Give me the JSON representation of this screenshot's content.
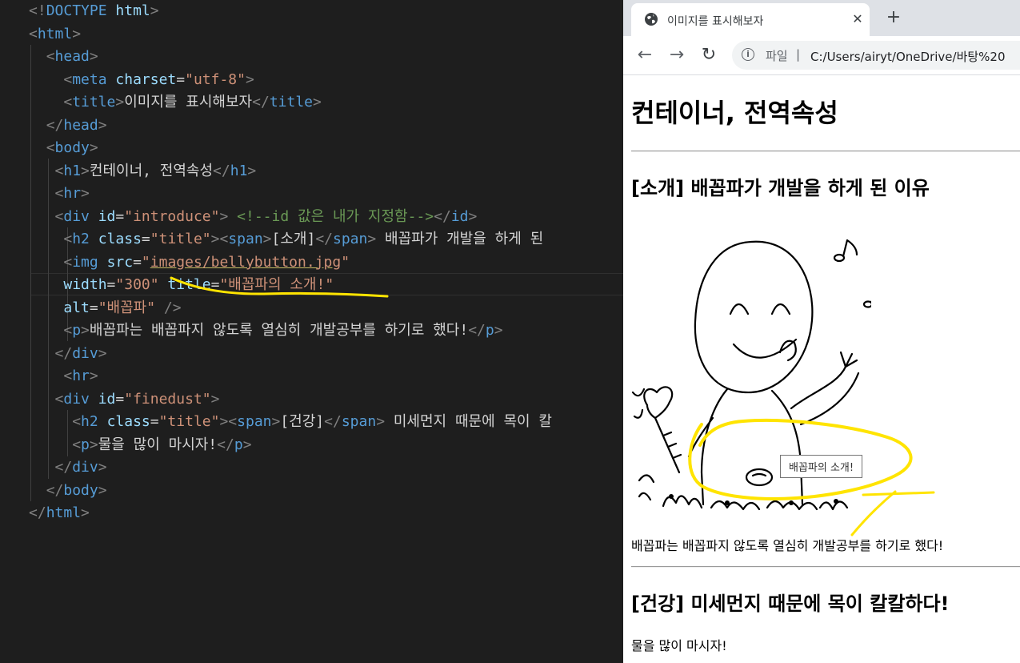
{
  "editor": {
    "lines": [
      [
        [
          "p",
          "<!"
        ],
        [
          "t",
          "DOCTYPE"
        ],
        [
          "x",
          " "
        ],
        [
          "a",
          "html"
        ],
        [
          "p",
          ">"
        ]
      ],
      [
        [
          "p",
          "<"
        ],
        [
          "t",
          "html"
        ],
        [
          "p",
          ">"
        ]
      ],
      [
        [
          "x",
          "  "
        ],
        [
          "p",
          "<"
        ],
        [
          "t",
          "head"
        ],
        [
          "p",
          ">"
        ]
      ],
      [
        [
          "x",
          "    "
        ],
        [
          "p",
          "<"
        ],
        [
          "t",
          "meta"
        ],
        [
          "x",
          " "
        ],
        [
          "a",
          "charset"
        ],
        [
          "x",
          "="
        ],
        [
          "s",
          "\"utf-8\""
        ],
        [
          "p",
          ">"
        ]
      ],
      [
        [
          "x",
          "    "
        ],
        [
          "p",
          "<"
        ],
        [
          "t",
          "title"
        ],
        [
          "p",
          ">"
        ],
        [
          "x",
          "이미지를 표시해보자"
        ],
        [
          "p",
          "</"
        ],
        [
          "t",
          "title"
        ],
        [
          "p",
          ">"
        ]
      ],
      [
        [
          "x",
          "  "
        ],
        [
          "p",
          "</"
        ],
        [
          "t",
          "head"
        ],
        [
          "p",
          ">"
        ]
      ],
      [
        [
          "x",
          "  "
        ],
        [
          "p",
          "<"
        ],
        [
          "t",
          "body"
        ],
        [
          "p",
          ">"
        ]
      ],
      [
        [
          "x",
          "   "
        ],
        [
          "p",
          "<"
        ],
        [
          "t",
          "h1"
        ],
        [
          "p",
          ">"
        ],
        [
          "x",
          "컨테이너, 전역속성"
        ],
        [
          "p",
          "</"
        ],
        [
          "t",
          "h1"
        ],
        [
          "p",
          ">"
        ]
      ],
      [
        [
          "x",
          "   "
        ],
        [
          "p",
          "<"
        ],
        [
          "t",
          "hr"
        ],
        [
          "p",
          ">"
        ]
      ],
      [
        [
          "x",
          "   "
        ],
        [
          "p",
          "<"
        ],
        [
          "t",
          "div"
        ],
        [
          "x",
          " "
        ],
        [
          "a",
          "id"
        ],
        [
          "x",
          "="
        ],
        [
          "s",
          "\"introduce\""
        ],
        [
          "p",
          ">"
        ],
        [
          "x",
          " "
        ],
        [
          "c",
          "<!--id 값은 내가 지정함-->"
        ],
        [
          "p",
          "</"
        ],
        [
          "t",
          "id"
        ],
        [
          "p",
          ">"
        ]
      ],
      [
        [
          "x",
          "    "
        ],
        [
          "p",
          "<"
        ],
        [
          "t",
          "h2"
        ],
        [
          "x",
          " "
        ],
        [
          "a",
          "class"
        ],
        [
          "x",
          "="
        ],
        [
          "s",
          "\"title\""
        ],
        [
          "p",
          ">"
        ],
        [
          "p",
          "<"
        ],
        [
          "t",
          "span"
        ],
        [
          "p",
          ">"
        ],
        [
          "x",
          "[소개]"
        ],
        [
          "p",
          "</"
        ],
        [
          "t",
          "span"
        ],
        [
          "p",
          ">"
        ],
        [
          "x",
          " 배꼽파가 개발을 하게 된"
        ]
      ],
      [
        [
          "x",
          "    "
        ],
        [
          "p",
          "<"
        ],
        [
          "t",
          "img"
        ],
        [
          "x",
          " "
        ],
        [
          "a",
          "src"
        ],
        [
          "x",
          "="
        ],
        [
          "s",
          "\""
        ],
        [
          "su",
          "images/bellybutton.jpg"
        ],
        [
          "s",
          "\""
        ]
      ],
      [
        [
          "x",
          "    "
        ],
        [
          "a",
          "width"
        ],
        [
          "x",
          "="
        ],
        [
          "s",
          "\"300\""
        ],
        [
          "x",
          " "
        ],
        [
          "a",
          "title"
        ],
        [
          "x",
          "="
        ],
        [
          "s",
          "\"배꼽파의 소개!\""
        ]
      ],
      [
        [
          "x",
          "    "
        ],
        [
          "a",
          "alt"
        ],
        [
          "x",
          "="
        ],
        [
          "s",
          "\"배꼽파\""
        ],
        [
          "x",
          " "
        ],
        [
          "p",
          "/>"
        ]
      ],
      [
        [
          "x",
          "    "
        ],
        [
          "p",
          "<"
        ],
        [
          "t",
          "p"
        ],
        [
          "p",
          ">"
        ],
        [
          "x",
          "배꼽파는 배꼽파지 않도록 열심히 개발공부를 하기로 했다!"
        ],
        [
          "p",
          "</"
        ],
        [
          "t",
          "p"
        ],
        [
          "p",
          ">"
        ]
      ],
      [
        [
          "x",
          "   "
        ],
        [
          "p",
          "</"
        ],
        [
          "t",
          "div"
        ],
        [
          "p",
          ">"
        ]
      ],
      [
        [
          "x",
          "    "
        ],
        [
          "p",
          "<"
        ],
        [
          "t",
          "hr"
        ],
        [
          "p",
          ">"
        ]
      ],
      [
        [
          "x",
          "   "
        ],
        [
          "p",
          "<"
        ],
        [
          "t",
          "div"
        ],
        [
          "x",
          " "
        ],
        [
          "a",
          "id"
        ],
        [
          "x",
          "="
        ],
        [
          "s",
          "\"finedust\""
        ],
        [
          "p",
          ">"
        ]
      ],
      [
        [
          "x",
          "     "
        ],
        [
          "p",
          "<"
        ],
        [
          "t",
          "h2"
        ],
        [
          "x",
          " "
        ],
        [
          "a",
          "class"
        ],
        [
          "x",
          "="
        ],
        [
          "s",
          "\"title\""
        ],
        [
          "p",
          ">"
        ],
        [
          "p",
          "<"
        ],
        [
          "t",
          "span"
        ],
        [
          "p",
          ">"
        ],
        [
          "x",
          "[건강]"
        ],
        [
          "p",
          "</"
        ],
        [
          "t",
          "span"
        ],
        [
          "p",
          ">"
        ],
        [
          "x",
          " 미세먼지 때문에 목이 칼"
        ]
      ],
      [
        [
          "x",
          "     "
        ],
        [
          "p",
          "<"
        ],
        [
          "t",
          "p"
        ],
        [
          "p",
          ">"
        ],
        [
          "x",
          "물을 많이 마시자!"
        ],
        [
          "p",
          "</"
        ],
        [
          "t",
          "p"
        ],
        [
          "p",
          ">"
        ]
      ],
      [
        [
          "x",
          "   "
        ],
        [
          "p",
          "</"
        ],
        [
          "t",
          "div"
        ],
        [
          "p",
          ">"
        ]
      ],
      [
        [
          "x",
          "  "
        ],
        [
          "p",
          "</"
        ],
        [
          "t",
          "body"
        ],
        [
          "p",
          ">"
        ]
      ],
      [
        [
          "p",
          "</"
        ],
        [
          "t",
          "html"
        ],
        [
          "p",
          ">"
        ]
      ]
    ]
  },
  "browser": {
    "tab_title": "이미지를 표시해보자",
    "tab_close": "✕",
    "new_tab": "+",
    "back": "←",
    "forward": "→",
    "reload": "↻",
    "info": "i",
    "file_label": "파일",
    "separator": "|",
    "url": "C:/Users/airyt/OneDrive/바탕%20"
  },
  "page": {
    "h1": "컨테이너, 전역속성",
    "intro_h2": "[소개] 배꼽파가 개발을 하게 된 이유",
    "image_tooltip": "배꼽파의 소개!",
    "intro_p": "배꼽파는 배꼽파지 않도록 열심히 개발공부를 하기로 했다!",
    "finedust_h2": "[건강] 미세먼지 때문에 목이 칼칼하다!",
    "finedust_p": "물을 많이 마시자!"
  },
  "colors": {
    "editor_bg": "#1e1e1e",
    "tag": "#569cd6",
    "attribute": "#9cdcfe",
    "string": "#ce9178",
    "comment": "#6a9955",
    "highlight_annotation": "#ffe400"
  }
}
